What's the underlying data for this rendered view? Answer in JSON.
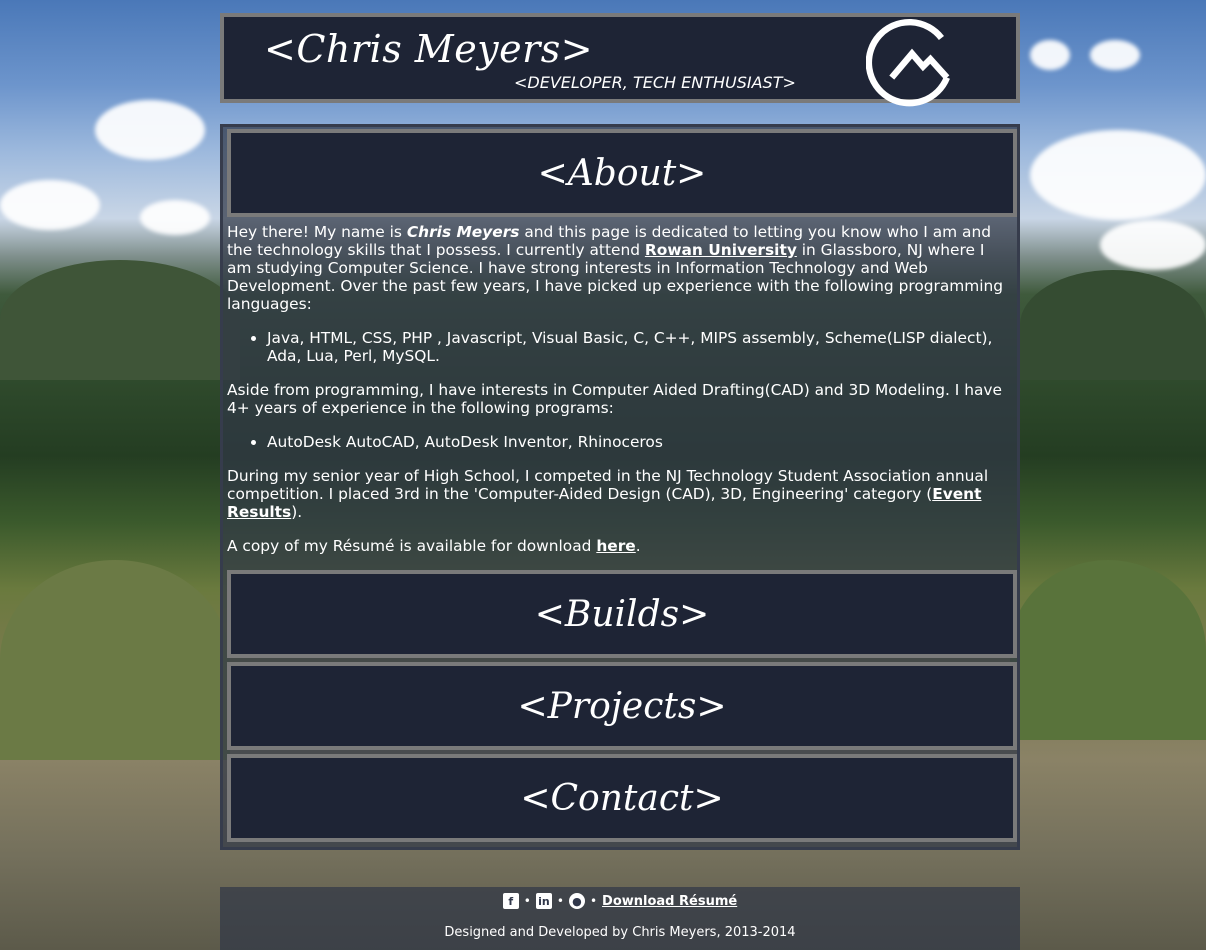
{
  "header": {
    "title": "<Chris Meyers>",
    "subtitle": "<DEVELOPER, TECH ENTHUSIAST>"
  },
  "sections": {
    "about": "<About>",
    "builds": "<Builds>",
    "projects": "<Projects>",
    "contact": "<Contact>"
  },
  "about": {
    "p1_a": "Hey there! My name is ",
    "p1_name": "Chris Meyers",
    "p1_b": " and this page is dedicated to letting you know who I am and the technology skills that I possess. I currently attend ",
    "p1_link": "Rowan University",
    "p1_c": " in Glassboro, NJ where I am studying Computer Science. I have strong interests in Information Technology and Web Development. Over the past few years, I have picked up experience with the following programming languages:",
    "languages": "Java, HTML, CSS, PHP , Javascript, Visual Basic, C, C++, MIPS assembly, Scheme(LISP dialect), Ada, Lua, Perl, MySQL.",
    "p2": "Aside from programming, I have interests in Computer Aided Drafting(CAD) and 3D Modeling. I have 4+ years of experience in the following programs:",
    "programs": "AutoDesk AutoCAD, AutoDesk Inventor, Rhinoceros",
    "p3_a": "During my senior year of High School, I competed in the NJ Technology Student Association annual competition. I placed 3rd in the 'Computer-Aided Design (CAD), 3D, Engineering' category (",
    "p3_link": "Event Results",
    "p3_b": ").",
    "p4_a": "A copy of my Résumé is available for download ",
    "p4_link": "here",
    "p4_b": "."
  },
  "footer": {
    "separator": "•",
    "icons": [
      "facebook-icon",
      "linkedin-icon",
      "github-icon"
    ],
    "download_label": "Download Résumé",
    "credit": "Designed and Developed by Chris Meyers, 2013-2014"
  },
  "colors": {
    "panel": "#1e2435",
    "panel_border": "#7a7a7a",
    "text": "#ffffff"
  }
}
